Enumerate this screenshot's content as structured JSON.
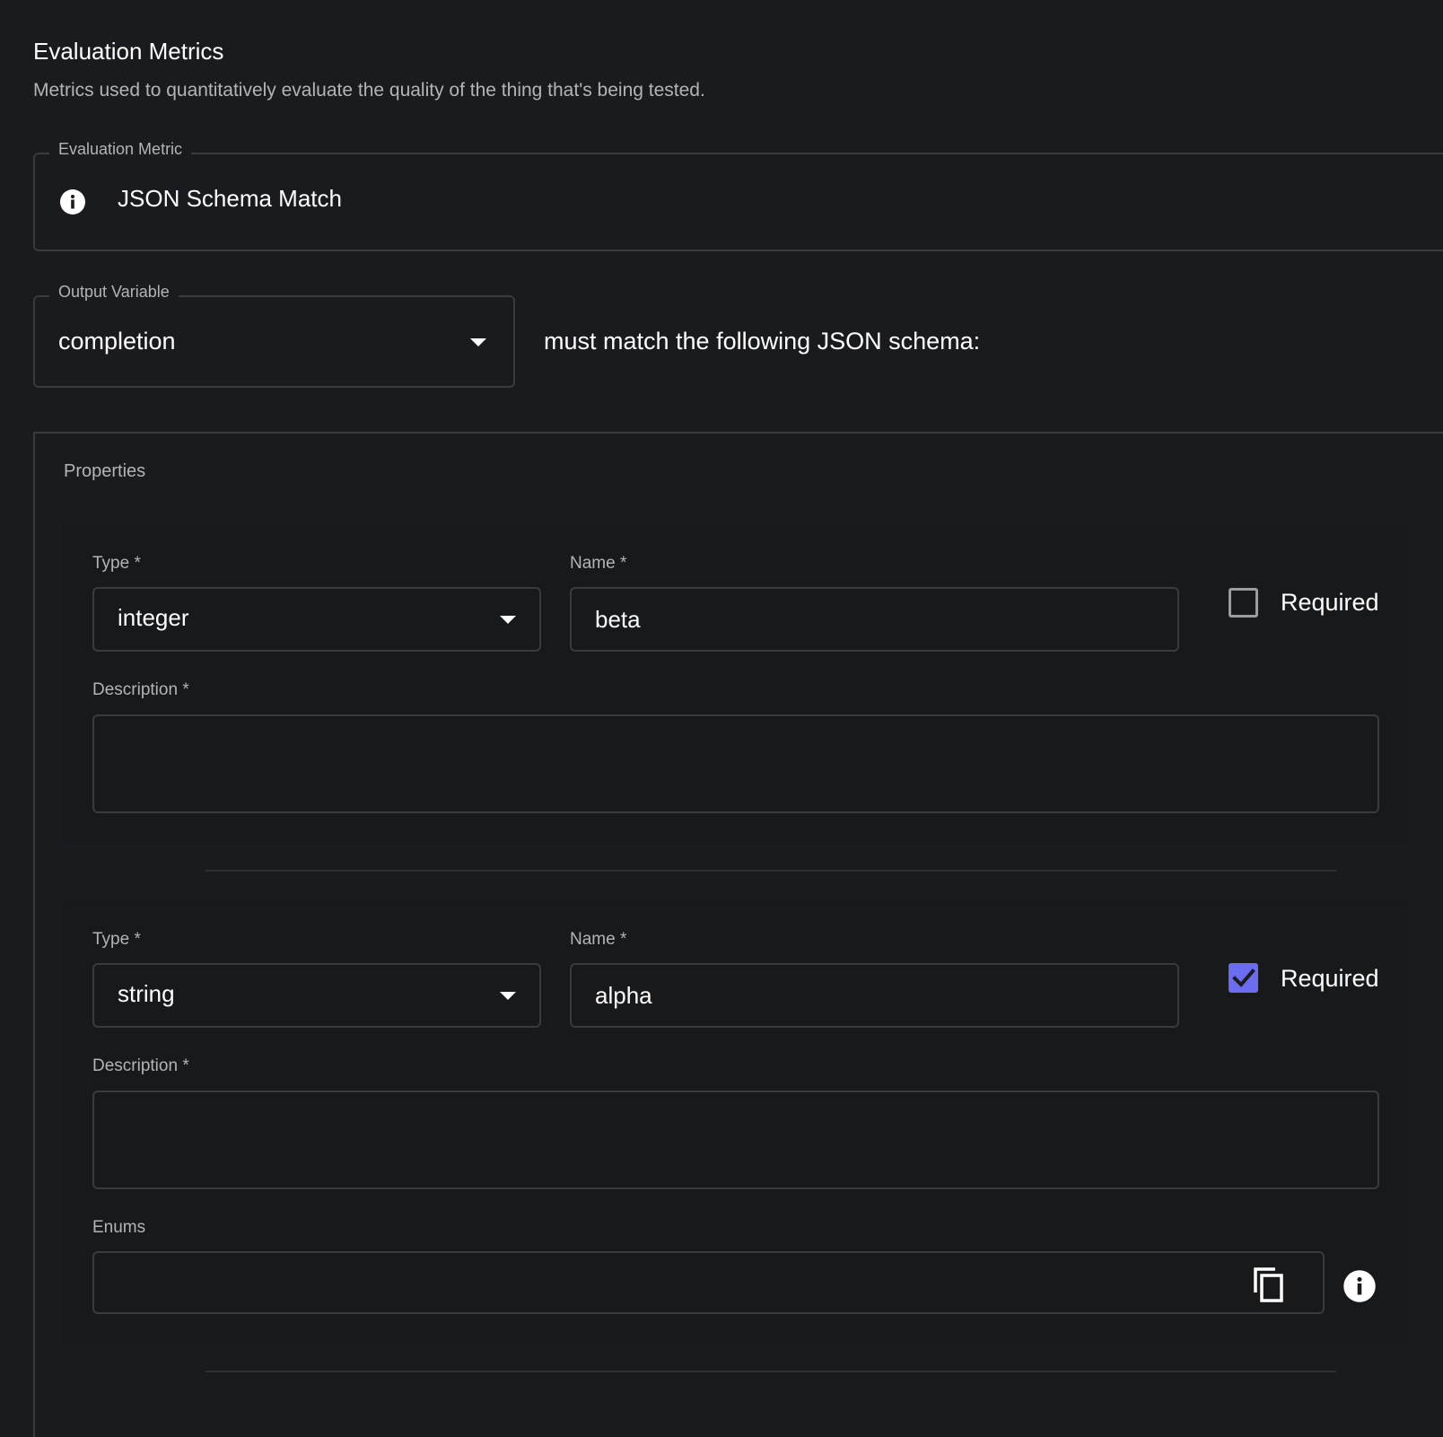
{
  "section": {
    "title": "Evaluation Metrics",
    "subtitle": "Metrics used to quantitatively evaluate the quality of the thing that's being tested."
  },
  "metric": {
    "legend": "Evaluation Metric",
    "value": "JSON Schema Match",
    "icon": "info-icon"
  },
  "output_variable": {
    "legend": "Output Variable",
    "value": "completion",
    "suffix": "must match the following JSON schema:"
  },
  "properties": {
    "label": "Properties",
    "items": [
      {
        "type_label": "Type *",
        "type_value": "integer",
        "name_label": "Name *",
        "name_value": "beta",
        "required_label": "Required",
        "required": false,
        "description_label": "Description *",
        "description_value": ""
      },
      {
        "type_label": "Type *",
        "type_value": "string",
        "name_label": "Name *",
        "name_value": "alpha",
        "required_label": "Required",
        "required": true,
        "description_label": "Description *",
        "description_value": "",
        "enums_label": "Enums",
        "enums_value": ""
      }
    ]
  },
  "colors": {
    "background": "#1a1b1e",
    "border": "#3a3b3f",
    "accent": "#6c6cf0"
  }
}
